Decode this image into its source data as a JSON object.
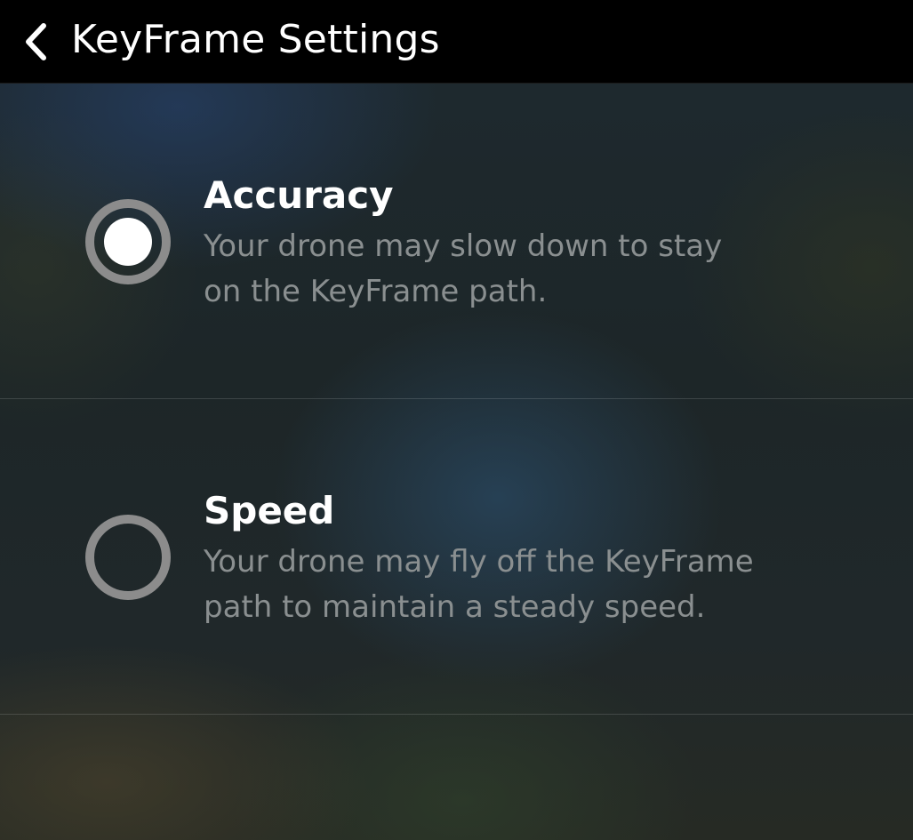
{
  "header": {
    "back_icon": "chevron-left-icon",
    "title": "KeyFrame Settings"
  },
  "options": [
    {
      "title": "Accuracy",
      "description_line1": "Your drone may slow down to stay",
      "description_line2": "on the KeyFrame path.",
      "selected": true
    },
    {
      "title": "Speed",
      "description_line1": "Your drone may fly off the KeyFrame",
      "description_line2": "path to maintain a steady speed.",
      "selected": false
    }
  ],
  "colors": {
    "header_bg": "#000000",
    "radio_ring": "#8c8c8c",
    "radio_dot": "#ffffff",
    "description_text": "#8a8f90"
  }
}
